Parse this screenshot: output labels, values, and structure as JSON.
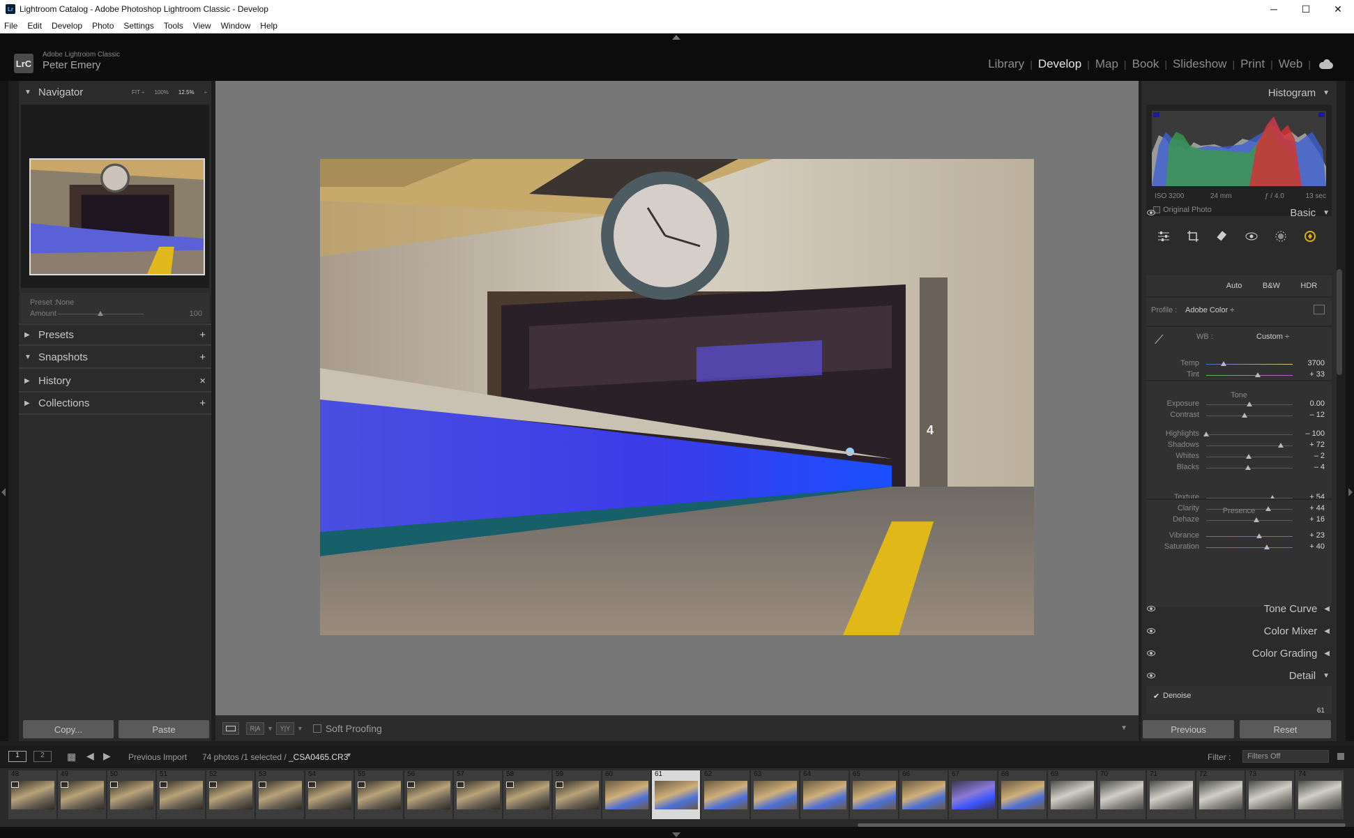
{
  "window": {
    "title": "Lightroom Catalog - Adobe Photoshop Lightroom Classic - Develop",
    "minimize": "─",
    "maximize": "☐",
    "close": "✕"
  },
  "menu": [
    "File",
    "Edit",
    "Develop",
    "Photo",
    "Settings",
    "Tools",
    "View",
    "Window",
    "Help"
  ],
  "identity": {
    "logo": "LrC",
    "app": "Adobe Lightroom Classic",
    "user": "Peter Emery"
  },
  "modules": [
    "Library",
    "Develop",
    "Map",
    "Book",
    "Slideshow",
    "Print",
    "Web"
  ],
  "active_module": "Develop",
  "navigator": {
    "title": "Navigator",
    "fit": "FIT ÷",
    "p100": "100%",
    "zoom": "12.5%",
    "zoom_arrow": "÷"
  },
  "preset": {
    "label": "Preset :",
    "value": "None",
    "amount_label": "Amount",
    "amount_value": "100",
    "amount_pos": 0.5
  },
  "left_panels": [
    {
      "label": "Presets",
      "action": "+"
    },
    {
      "label": "Snapshots",
      "action": "+"
    },
    {
      "label": "History",
      "action": "×"
    },
    {
      "label": "Collections",
      "action": "+"
    }
  ],
  "left_buttons": {
    "copy": "Copy...",
    "paste": "Paste"
  },
  "toolbar": {
    "soft_proofing": "Soft Proofing",
    "ra": "R|A",
    "yy": "Y|Y"
  },
  "histogram": {
    "title": "Histogram",
    "iso": "ISO 3200",
    "focal": "24 mm",
    "aperture": "ƒ / 4.0",
    "shutter": "13 sec",
    "original_photo": "Original Photo"
  },
  "basic": {
    "title": "Basic",
    "auto": "Auto",
    "bw": "B&W",
    "hdr": "HDR",
    "profile_label": "Profile :",
    "profile_value": "Adobe Color ÷",
    "wb_label": "WB :",
    "wb_value": "Custom ÷",
    "tone_label": "Tone",
    "presence_label": "Presence",
    "sliders": {
      "temp": {
        "label": "Temp",
        "value": "3700",
        "pos": 0.2
      },
      "tint": {
        "label": "Tint",
        "value": "+ 33",
        "pos": 0.6
      },
      "exposure": {
        "label": "Exposure",
        "value": "0.00",
        "pos": 0.5
      },
      "contrast": {
        "label": "Contrast",
        "value": "– 12",
        "pos": 0.44
      },
      "highlights": {
        "label": "Highlights",
        "value": "– 100",
        "pos": 0.0
      },
      "shadows": {
        "label": "Shadows",
        "value": "+ 72",
        "pos": 0.86
      },
      "whites": {
        "label": "Whites",
        "value": "– 2",
        "pos": 0.49
      },
      "blacks": {
        "label": "Blacks",
        "value": "– 4",
        "pos": 0.48
      },
      "texture": {
        "label": "Texture",
        "value": "+ 54",
        "pos": 0.77
      },
      "clarity": {
        "label": "Clarity",
        "value": "+ 44",
        "pos": 0.72
      },
      "dehaze": {
        "label": "Dehaze",
        "value": "+ 16",
        "pos": 0.58
      },
      "vibrance": {
        "label": "Vibrance",
        "value": "+ 23",
        "pos": 0.61
      },
      "saturation": {
        "label": "Saturation",
        "value": "+ 40",
        "pos": 0.7
      }
    }
  },
  "right_panels": [
    "Tone Curve",
    "Color Mixer",
    "Color Grading",
    "Detail"
  ],
  "detail": {
    "denoise": "Denoise",
    "denoise_value": "61"
  },
  "right_buttons": {
    "previous": "Previous",
    "reset": "Reset"
  },
  "filmbar": {
    "screen1": "1",
    "screen2": "2",
    "source": "Previous Import",
    "count": "74 photos /1 selected /",
    "file": "_CSA0465.CR3",
    "filter_label": "Filter :",
    "filter_value": "Filters Off"
  },
  "filmstrip": {
    "selected": "61",
    "numbers": [
      "48",
      "49",
      "50",
      "51",
      "52",
      "53",
      "54",
      "55",
      "56",
      "57",
      "58",
      "59",
      "60",
      "61",
      "62",
      "63",
      "64",
      "65",
      "66",
      "67",
      "68",
      "69",
      "70",
      "71",
      "72",
      "73",
      "74"
    ]
  },
  "colors": {
    "panel_bg": "#2b2b2b",
    "canvas_bg": "#777777",
    "accent_yellow": "#e4b400",
    "accent_blue": "#3b54ff"
  }
}
